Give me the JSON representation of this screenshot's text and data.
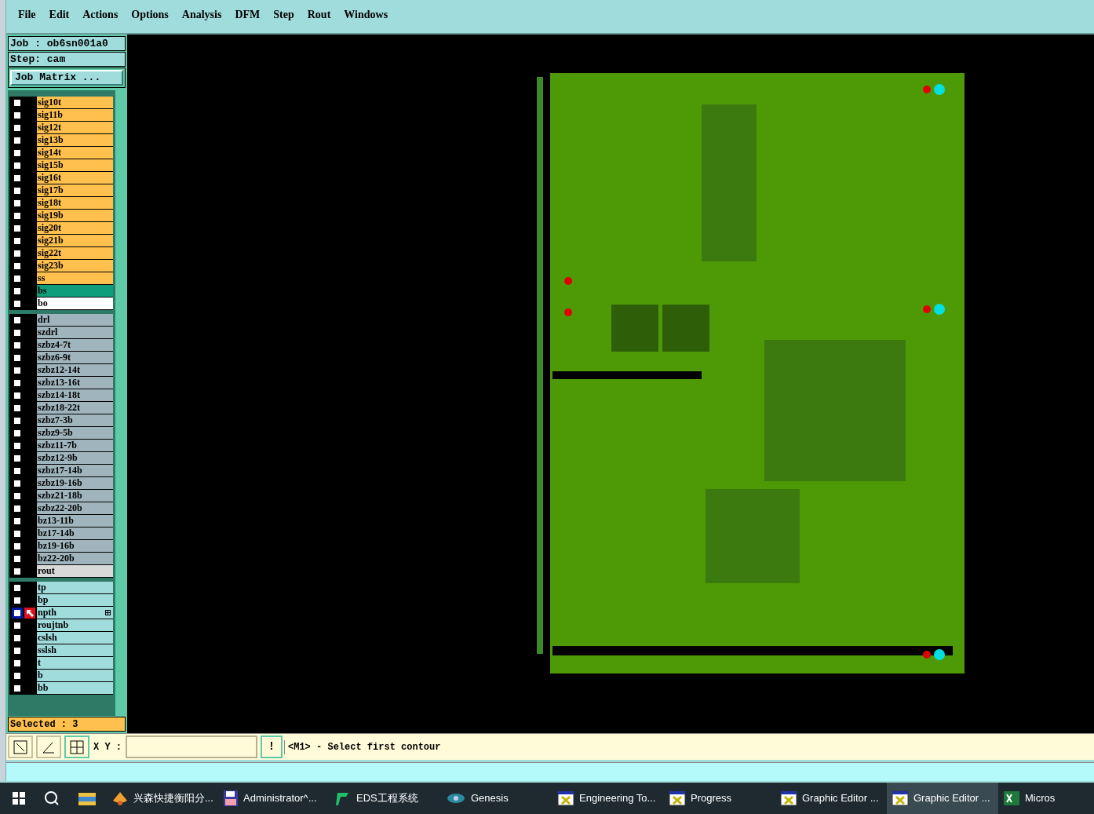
{
  "menu": [
    "File",
    "Edit",
    "Actions",
    "Options",
    "Analysis",
    "DFM",
    "Step",
    "Rout",
    "Windows"
  ],
  "job": {
    "job_label": "Job : ob6sn001a0",
    "step_label": "Step: cam",
    "matrix_button": "Job Matrix ..."
  },
  "layer_groups": [
    {
      "layers": [
        {
          "name": "sig10t",
          "color": "#ffc04d",
          "checked": false,
          "active": false
        },
        {
          "name": "sig11b",
          "color": "#ffc04d",
          "checked": false,
          "active": false
        },
        {
          "name": "sig12t",
          "color": "#ffc04d",
          "checked": false,
          "active": false
        },
        {
          "name": "sig13b",
          "color": "#ffc04d",
          "checked": false,
          "active": false
        },
        {
          "name": "sig14t",
          "color": "#ffc04d",
          "checked": false,
          "active": false
        },
        {
          "name": "sig15b",
          "color": "#ffc04d",
          "checked": false,
          "active": false
        },
        {
          "name": "sig16t",
          "color": "#ffc04d",
          "checked": false,
          "active": false
        },
        {
          "name": "sig17b",
          "color": "#ffc04d",
          "checked": false,
          "active": false
        },
        {
          "name": "sig18t",
          "color": "#ffc04d",
          "checked": false,
          "active": false
        },
        {
          "name": "sig19b",
          "color": "#ffc04d",
          "checked": false,
          "active": false
        },
        {
          "name": "sig20t",
          "color": "#ffc04d",
          "checked": false,
          "active": false
        },
        {
          "name": "sig21b",
          "color": "#ffc04d",
          "checked": false,
          "active": false
        },
        {
          "name": "sig22t",
          "color": "#ffc04d",
          "checked": false,
          "active": false
        },
        {
          "name": "sig23b",
          "color": "#ffc04d",
          "checked": false,
          "active": false
        },
        {
          "name": "ss",
          "color": "#ffc04d",
          "checked": false,
          "active": false
        },
        {
          "name": "bs",
          "color": "#0f9e7c",
          "checked": false,
          "active": false
        },
        {
          "name": "bo",
          "color": "#ffffff",
          "checked": false,
          "active": false
        }
      ]
    },
    {
      "layers": [
        {
          "name": "drl",
          "color": "#9fb4bc",
          "checked": false,
          "active": false
        },
        {
          "name": "szdrl",
          "color": "#9fb4bc",
          "checked": false,
          "active": false
        },
        {
          "name": "szbz4-7t",
          "color": "#9fb4bc",
          "checked": false,
          "active": false
        },
        {
          "name": "szbz6-9t",
          "color": "#9fb4bc",
          "checked": false,
          "active": false
        },
        {
          "name": "szbz12-14t",
          "color": "#9fb4bc",
          "checked": false,
          "active": false
        },
        {
          "name": "szbz13-16t",
          "color": "#9fb4bc",
          "checked": false,
          "active": false
        },
        {
          "name": "szbz14-18t",
          "color": "#9fb4bc",
          "checked": false,
          "active": false
        },
        {
          "name": "szbz18-22t",
          "color": "#9fb4bc",
          "checked": false,
          "active": false
        },
        {
          "name": "szbz7-3b",
          "color": "#9fb4bc",
          "checked": false,
          "active": false
        },
        {
          "name": "szbz9-5b",
          "color": "#9fb4bc",
          "checked": false,
          "active": false
        },
        {
          "name": "szbz11-7b",
          "color": "#9fb4bc",
          "checked": false,
          "active": false
        },
        {
          "name": "szbz12-9b",
          "color": "#9fb4bc",
          "checked": false,
          "active": false
        },
        {
          "name": "szbz17-14b",
          "color": "#9fb4bc",
          "checked": false,
          "active": false
        },
        {
          "name": "szbz19-16b",
          "color": "#9fb4bc",
          "checked": false,
          "active": false
        },
        {
          "name": "szbz21-18b",
          "color": "#9fb4bc",
          "checked": false,
          "active": false
        },
        {
          "name": "szbz22-20b",
          "color": "#9fb4bc",
          "checked": false,
          "active": false
        },
        {
          "name": "bz13-11b",
          "color": "#9fb4bc",
          "checked": false,
          "active": false
        },
        {
          "name": "bz17-14b",
          "color": "#9fb4bc",
          "checked": false,
          "active": false
        },
        {
          "name": "bz19-16b",
          "color": "#9fb4bc",
          "checked": false,
          "active": false
        },
        {
          "name": "bz22-20b",
          "color": "#9fb4bc",
          "checked": false,
          "active": false
        },
        {
          "name": "rout",
          "color": "#d9d9d9",
          "checked": false,
          "active": false
        }
      ]
    },
    {
      "layers": [
        {
          "name": "tp",
          "color": "#a0dcdc",
          "checked": false,
          "active": false
        },
        {
          "name": "bp",
          "color": "#a0dcdc",
          "checked": false,
          "active": false
        },
        {
          "name": "npth",
          "color": "#a0dcdc",
          "checked": false,
          "active": true
        },
        {
          "name": "roujtnb",
          "color": "#a0dcdc",
          "checked": false,
          "active": false
        },
        {
          "name": "cslsh",
          "color": "#a0dcdc",
          "checked": false,
          "active": false
        },
        {
          "name": "sslsh",
          "color": "#a0dcdc",
          "checked": false,
          "active": false
        },
        {
          "name": "t",
          "color": "#a0dcdc",
          "checked": false,
          "active": false
        },
        {
          "name": "b",
          "color": "#a0dcdc",
          "checked": false,
          "active": false
        },
        {
          "name": "bb",
          "color": "#a0dcdc",
          "checked": false,
          "active": false
        }
      ]
    }
  ],
  "selected_count": "Selected : 3",
  "command_bar": {
    "xy_label": "X Y :",
    "alert_button": "!",
    "message": "<M1> - Select first contour"
  },
  "taskbar": [
    {
      "label": "兴森快捷衡阳分...",
      "selected": false
    },
    {
      "label": "Administrator^...",
      "selected": false
    },
    {
      "label": "EDS工程系统",
      "selected": false
    },
    {
      "label": "Genesis",
      "selected": false
    },
    {
      "label": "Engineering To...",
      "selected": false
    },
    {
      "label": "Progress",
      "selected": false
    },
    {
      "label": "Graphic Editor ...",
      "selected": false
    },
    {
      "label": "Graphic Editor ...",
      "selected": true
    },
    {
      "label": "Micros",
      "selected": false
    }
  ]
}
